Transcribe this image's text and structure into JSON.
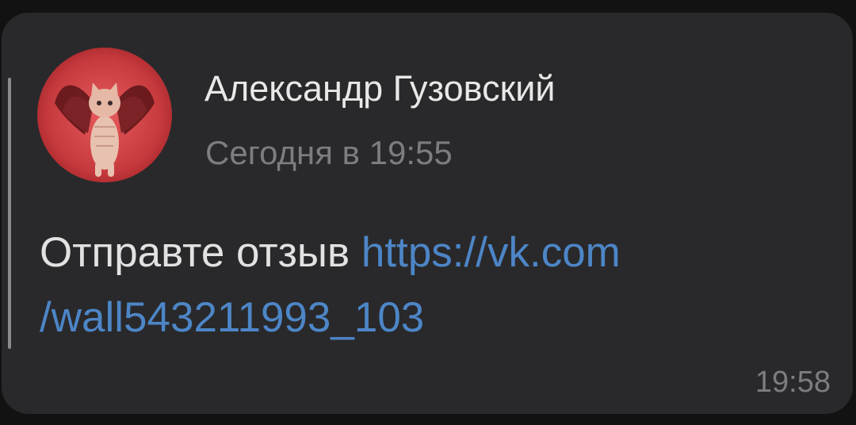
{
  "message": {
    "sender_name": "Александр Гузовский",
    "sent_time": "Сегодня в 19:55",
    "text": "Отправте отзыв ",
    "link_line1": "https://vk.com",
    "link_line2": "/wall543211993_103",
    "time": "19:58"
  },
  "colors": {
    "bubble_background": "#29292b",
    "name_text": "#e8e8e8",
    "meta_text": "#7d7d80",
    "link": "#4d86c7",
    "quote_bar": "#8b8b8f",
    "avatar_background": "#c63a3e"
  },
  "avatar": {
    "icon": "cat-with-wings-avatar-icon"
  }
}
